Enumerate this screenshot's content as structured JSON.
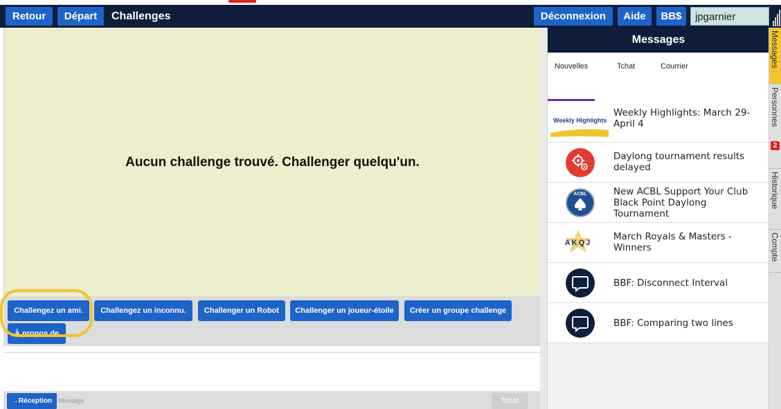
{
  "toolbar": {
    "back_label": "Retour",
    "home_label": "Départ",
    "title": "Challenges",
    "logout_label": "Déconnexion",
    "help_label": "Aide",
    "bbdollars_label": "BB$",
    "username": "jpgarnier"
  },
  "challenges": {
    "empty_message": "Aucun challenge trouvé. Challenger quelqu'un.",
    "buttons": [
      "Challengez un ami.",
      "Challengez un inconnu.",
      "Challenger un Robot",
      "Challenger un joueur-étoile",
      "Créer un groupe challenge",
      "À propos de"
    ]
  },
  "chat": {
    "reception_label": "→Réception",
    "placeholder": "Message",
    "send_label": "Tchat"
  },
  "messages_panel": {
    "title": "Messages",
    "tabs": [
      "Nouvelles",
      "Tchat",
      "Courrier"
    ],
    "active_tab": "Nouvelles",
    "news": [
      {
        "icon": "weekly-highlights-logo",
        "thumb_text": "Weekly Highlights",
        "title": "Weekly Highlights: March 29-April 4"
      },
      {
        "icon": "gears-icon",
        "title": "Daylong tournament results delayed"
      },
      {
        "icon": "acbl-logo",
        "thumb_text": "ACBL",
        "title": "New ACBL Support Your Club Black Point Daylong Tournament"
      },
      {
        "icon": "akqj-logo",
        "thumb_text": "AKQJ",
        "title": "March Royals & Masters - Winners"
      },
      {
        "icon": "chat-bubble-icon",
        "title": "BBF: Disconnect Interval"
      },
      {
        "icon": "chat-bubble-icon",
        "title": "BBF: Comparing two lines"
      }
    ]
  },
  "side_tabs": [
    {
      "label": "Messages",
      "active": true
    },
    {
      "label": "Personnes",
      "badge": "2"
    },
    {
      "label": "Historique"
    },
    {
      "label": "Compte"
    }
  ],
  "colors": {
    "toolbar_bg": "#0f1d3a",
    "button_blue": "#1e63c7",
    "challenge_bg": "#edeecd",
    "highlight": "#f3c431",
    "tab_active": "#f3c431"
  }
}
